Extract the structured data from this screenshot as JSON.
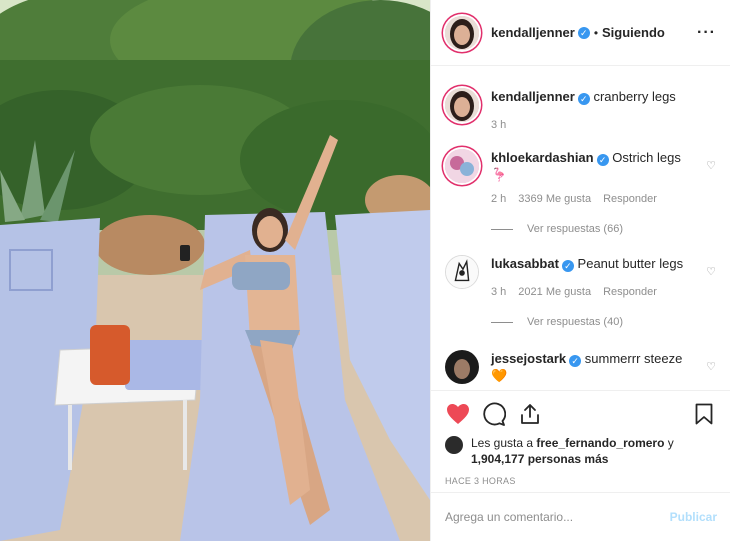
{
  "header": {
    "username": "kendalljenner",
    "separator": "•",
    "follow_status": "Siguiendo",
    "more_icon": "ellipsis-icon"
  },
  "caption": {
    "username": "kendalljenner",
    "text": "cranberry legs",
    "age": "3 h"
  },
  "comments": [
    {
      "username": "khloekardashian",
      "text": "Ostrich legs",
      "emoji": "🦩",
      "age": "2 h",
      "likes": "3369 Me gusta",
      "reply": "Responder",
      "replies": "Ver respuestas (66)"
    },
    {
      "username": "lukasabbat",
      "text": "Peanut butter legs",
      "age": "3 h",
      "likes": "2021 Me gusta",
      "reply": "Responder",
      "replies": "Ver respuestas (40)"
    },
    {
      "username": "jessejostark",
      "text": "summerrr steeze",
      "emoji": "🧡"
    }
  ],
  "likes": {
    "prefix": "Les gusta a",
    "user": "free_fernando_romero",
    "joiner": "y",
    "rest": "1,904,177 personas más"
  },
  "timestamp": "HACE 3 HORAS",
  "comment_box": {
    "placeholder": "Agrega un comentario...",
    "publish": "Publicar"
  },
  "colors": {
    "like_red": "#ed4956",
    "verified_blue": "#3897f0",
    "publish_disabled": "#b2dffc",
    "story_ring": "#e1306c"
  }
}
